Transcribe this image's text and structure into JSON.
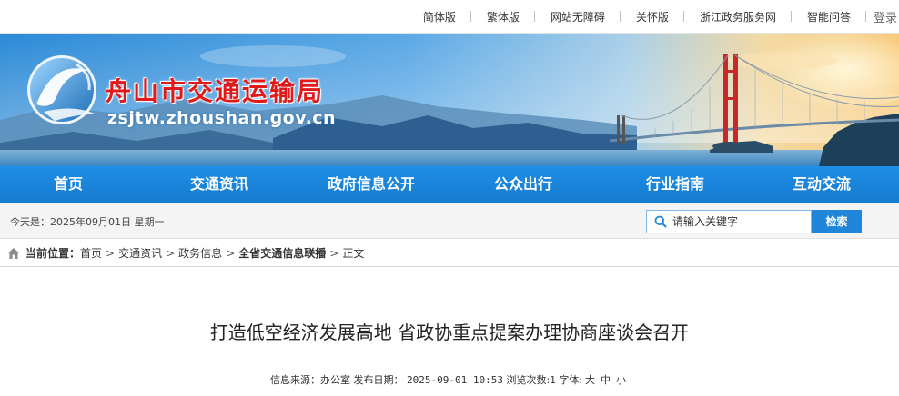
{
  "top_links": [
    "简体版",
    "繁体版",
    "网站无障碍",
    "关怀版",
    "浙江政务服务网",
    "智能问答"
  ],
  "login_label": "登录",
  "site": {
    "title": "舟山市交通运输局",
    "domain": "zsjtw.zhoushan.gov.cn"
  },
  "nav": [
    "首页",
    "交通资讯",
    "政府信息公开",
    "公众出行",
    "行业指南",
    "互动交流"
  ],
  "infobar": {
    "today": "今天是：2025年09月01日  星期一",
    "search_placeholder": "请输入关键字",
    "search_button": "检索"
  },
  "breadcrumb": {
    "label": "当前位置：",
    "items": [
      "首页",
      "交通资讯",
      "政务信息",
      "全省交通信息联播",
      "正文"
    ],
    "separator": ">"
  },
  "article": {
    "title": "打造低空经济发展高地 省政协重点提案办理协商座谈会召开",
    "source_label": "信息来源：",
    "source": "办公室",
    "date_label": "发布日期：",
    "date": "2025-09-01 10:53",
    "views_label": "浏览次数:",
    "views": "1",
    "font_label": "字体:",
    "font_sizes": [
      "大",
      "中",
      "小"
    ]
  },
  "colors": {
    "nav_blue": "#1785d8",
    "title_red": "#e01a1a",
    "bridge_red": "#c8282a"
  },
  "icons": [
    "search-icon",
    "home-icon",
    "logo-emblem-icon"
  ]
}
